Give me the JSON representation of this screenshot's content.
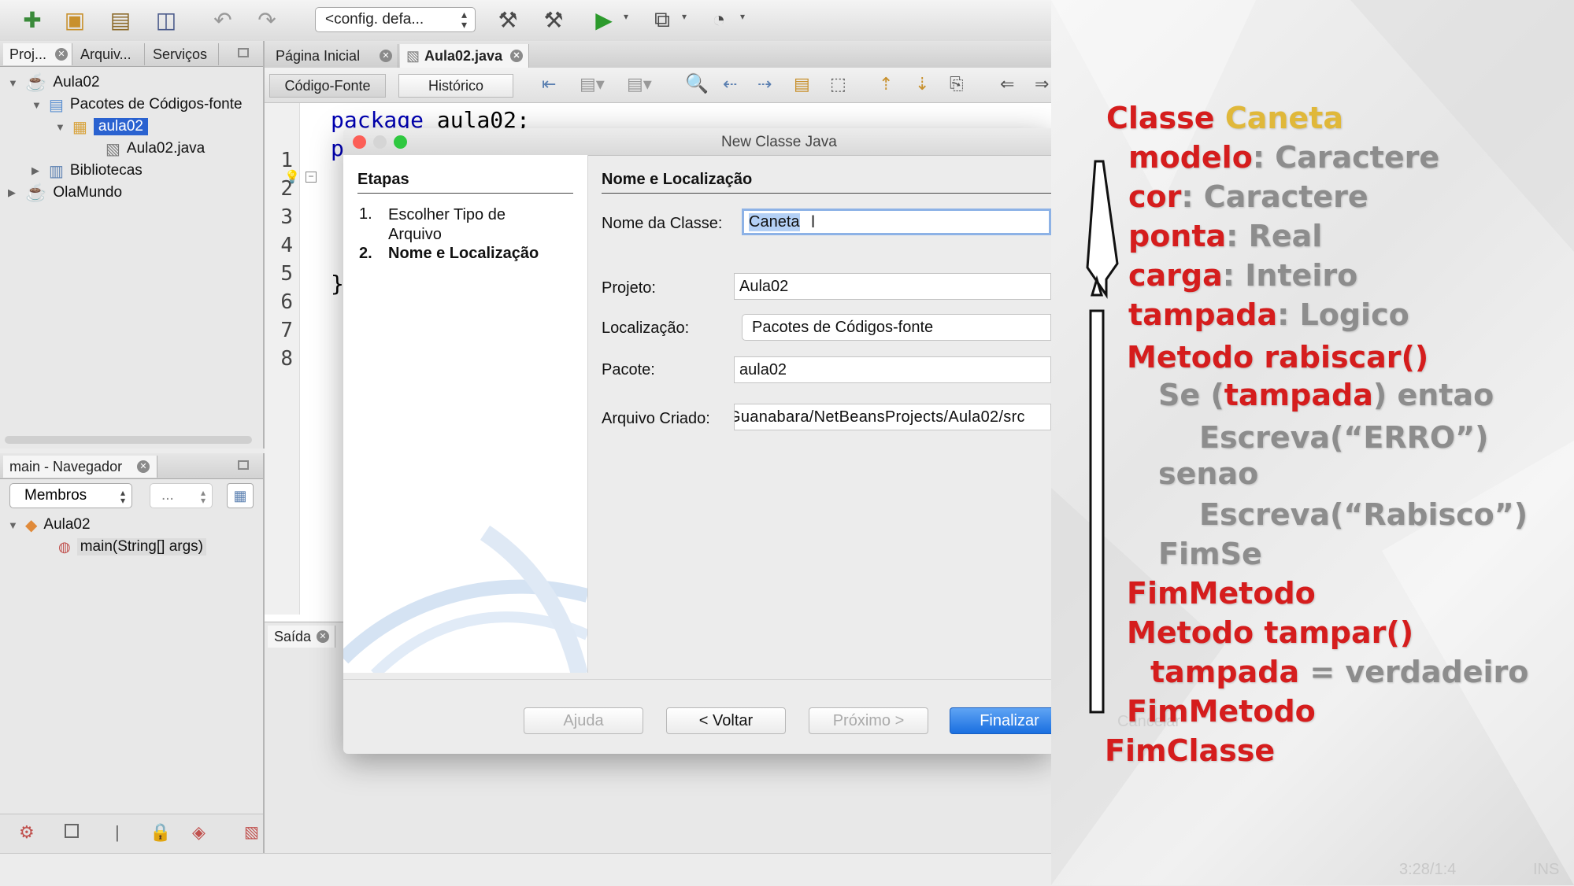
{
  "toolbar": {
    "icons": [
      "new-file-icon",
      "new-project-icon",
      "open-project-icon",
      "save-all-icon",
      "undo-icon",
      "redo-icon",
      "build-icon",
      "clean-build-icon",
      "run-icon",
      "debug-icon",
      "profile-icon"
    ],
    "config_select": "<config. defa..."
  },
  "projects_panel": {
    "tabs": [
      "Proj...",
      "Arquiv...",
      "Serviços"
    ],
    "tree": [
      {
        "label": "Aula02"
      },
      {
        "label": "Pacotes de Códigos-fonte"
      },
      {
        "label": "aula02"
      },
      {
        "label": "Aula02.java"
      },
      {
        "label": "Bibliotecas"
      },
      {
        "label": "OlaMundo"
      }
    ]
  },
  "navigator_panel": {
    "title": "main - Navegador",
    "filter_select": "Membros",
    "second_select": "...",
    "tree": [
      {
        "label": "Aula02"
      },
      {
        "label": "main(String[] args)"
      }
    ]
  },
  "editor": {
    "tabs": [
      "Página Inicial",
      "Aula02.java"
    ],
    "sub_buttons": [
      "Código-Fonte",
      "Histórico"
    ],
    "line_numbers": [
      "1",
      "2",
      "3",
      "4",
      "5",
      "6",
      "7",
      "8"
    ],
    "code_line1_kw": "package",
    "code_line1_rest": " aula02;",
    "code_line2": "p",
    "code_line7": "}"
  },
  "output_panel": {
    "tab": "Saída"
  },
  "dialog": {
    "title": "New Classe Java",
    "steps_heading": "Etapas",
    "steps": [
      {
        "num": "1.",
        "label": "Escolher Tipo de Arquivo"
      },
      {
        "num": "2.",
        "label": "Nome e Localização"
      }
    ],
    "section_heading": "Nome e Localização",
    "fields": {
      "class_name": {
        "label": "Nome da Classe:",
        "value": "Caneta"
      },
      "project": {
        "label": "Projeto:",
        "value": "Aula02"
      },
      "location": {
        "label": "Localização:",
        "value": "Pacotes de Códigos-fonte"
      },
      "package": {
        "label": "Pacote:",
        "value": "aula02"
      },
      "created_file": {
        "label": "Arquivo Criado:",
        "value": "Guanabara/NetBeansProjects/Aula02/src"
      }
    },
    "buttons": {
      "help": "Ajuda",
      "back": "< Voltar",
      "next": "Próximo >",
      "finish": "Finalizar",
      "cancel": "Cancelar"
    }
  },
  "pseudocode": {
    "class_kw": "Classe",
    "class_name": "Caneta",
    "attributes": [
      {
        "name": "modelo",
        "type": ": Caractere"
      },
      {
        "name": "cor",
        "type": ": Caractere"
      },
      {
        "name": "ponta",
        "type": ": Real"
      },
      {
        "name": "carga",
        "type": ": Inteiro"
      },
      {
        "name": "tampada",
        "type": ": Logico"
      }
    ],
    "method1_kw": "Metodo",
    "method1_name": "rabiscar()",
    "if_pre": "Se (",
    "if_var": "tampada",
    "if_post": ") entao",
    "write_erro": "Escreva(“ERRO”)",
    "else": "senao",
    "write_rabisco": "Escreva(“Rabisco”)",
    "endif": "FimSe",
    "endmethod1": "FimMetodo",
    "method2_kw": "Metodo",
    "method2_name": "tampar()",
    "assign_var": "tampada",
    "assign_rest": " = verdadeiro",
    "endmethod2": "FimMetodo",
    "endclass": "FimClasse"
  },
  "status_bar": {
    "position": "3:28/1:4",
    "mode": "INS"
  }
}
